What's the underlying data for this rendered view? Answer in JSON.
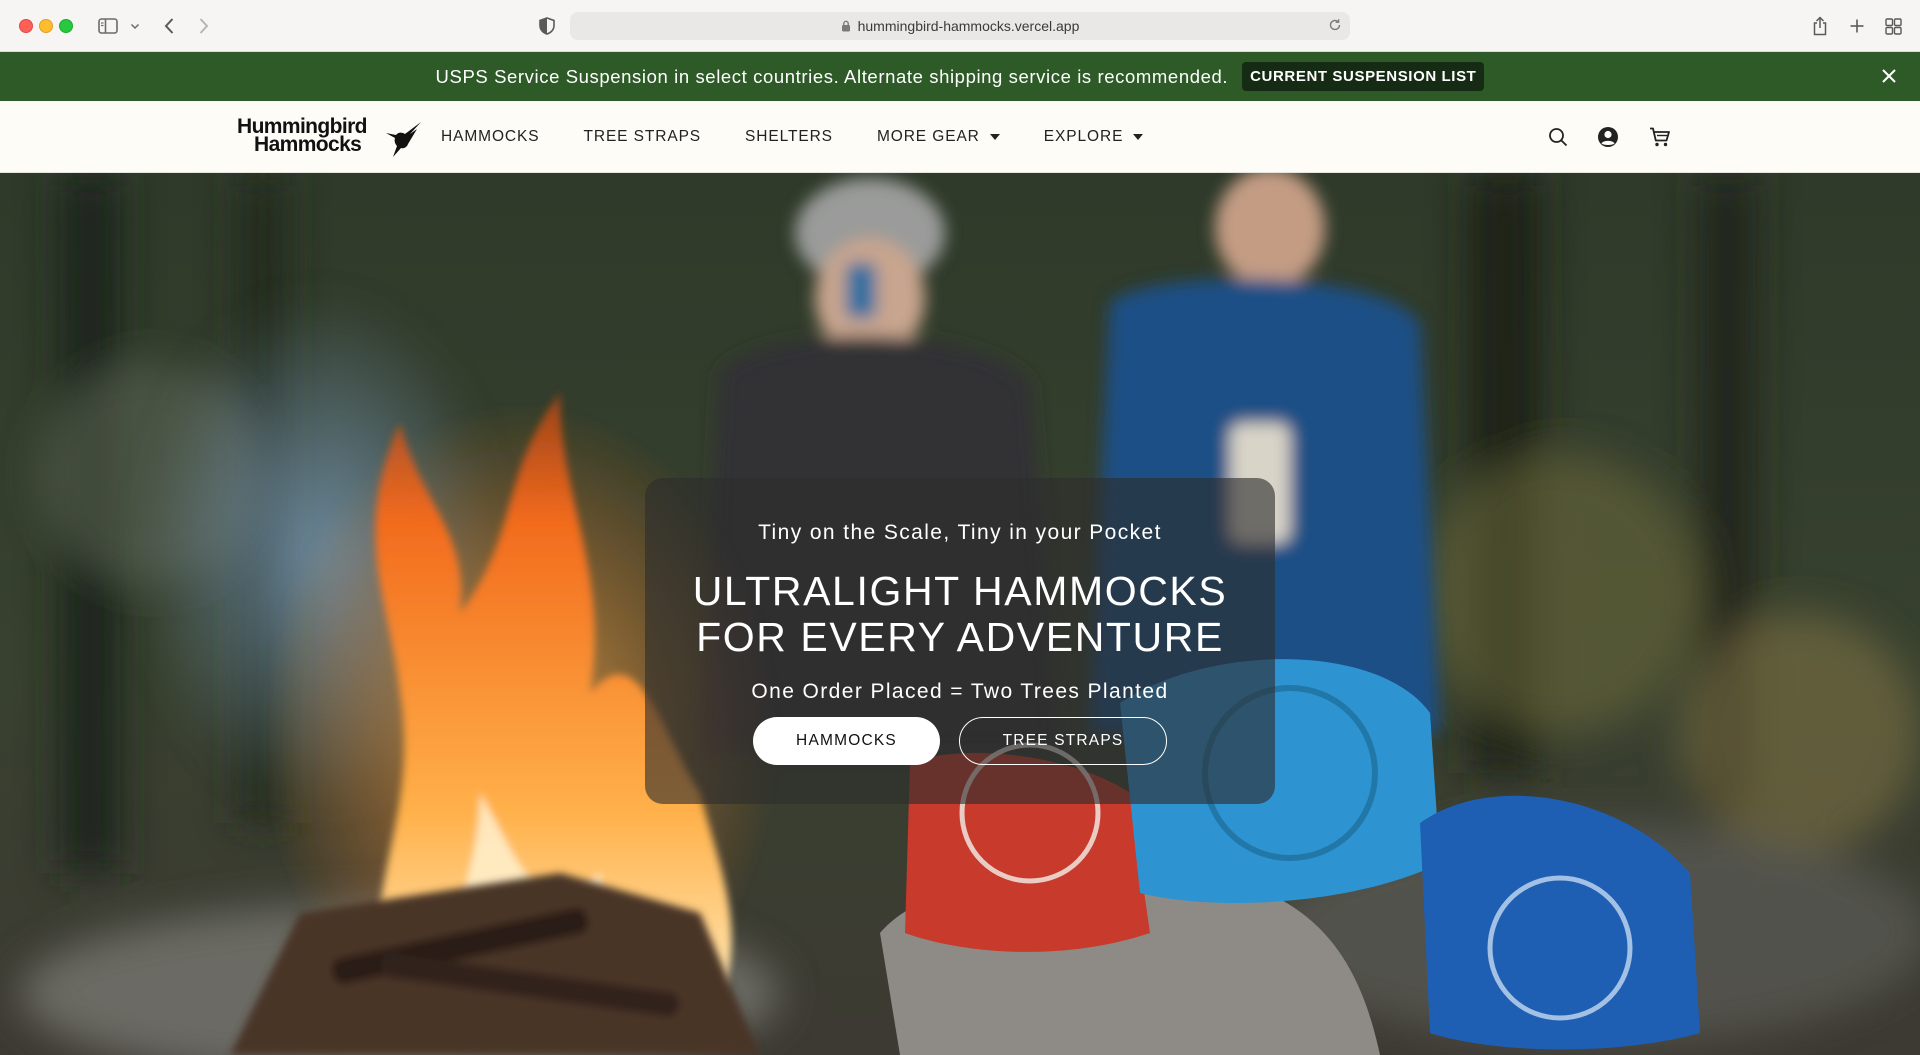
{
  "browser": {
    "url": "hummingbird-hammocks.vercel.app"
  },
  "announcement": {
    "text": "USPS Service Suspension in select countries. Alternate shipping service is recommended.",
    "button_label": "CURRENT SUSPENSION LIST"
  },
  "header": {
    "logo_line1": "Hummingbird",
    "logo_line2": "Hammocks",
    "nav": [
      {
        "label": "HAMMOCKS",
        "dropdown": false
      },
      {
        "label": "TREE STRAPS",
        "dropdown": false
      },
      {
        "label": "SHELTERS",
        "dropdown": false
      },
      {
        "label": "MORE GEAR",
        "dropdown": true
      },
      {
        "label": "EXPLORE",
        "dropdown": true
      }
    ]
  },
  "hero": {
    "subtitle": "Tiny on the Scale, Tiny in your Pocket",
    "title_line1": "ULTRALIGHT HAMMOCKS",
    "title_line2": "FOR EVERY ADVENTURE",
    "tagline": "One Order Placed = Two Trees Planted",
    "primary_button": "HAMMOCKS",
    "secondary_button": "TREE STRAPS"
  },
  "colors": {
    "announcement_bg": "#2d5a27",
    "announcement_button_bg": "#152b13",
    "header_bg": "#fdfcf7"
  }
}
